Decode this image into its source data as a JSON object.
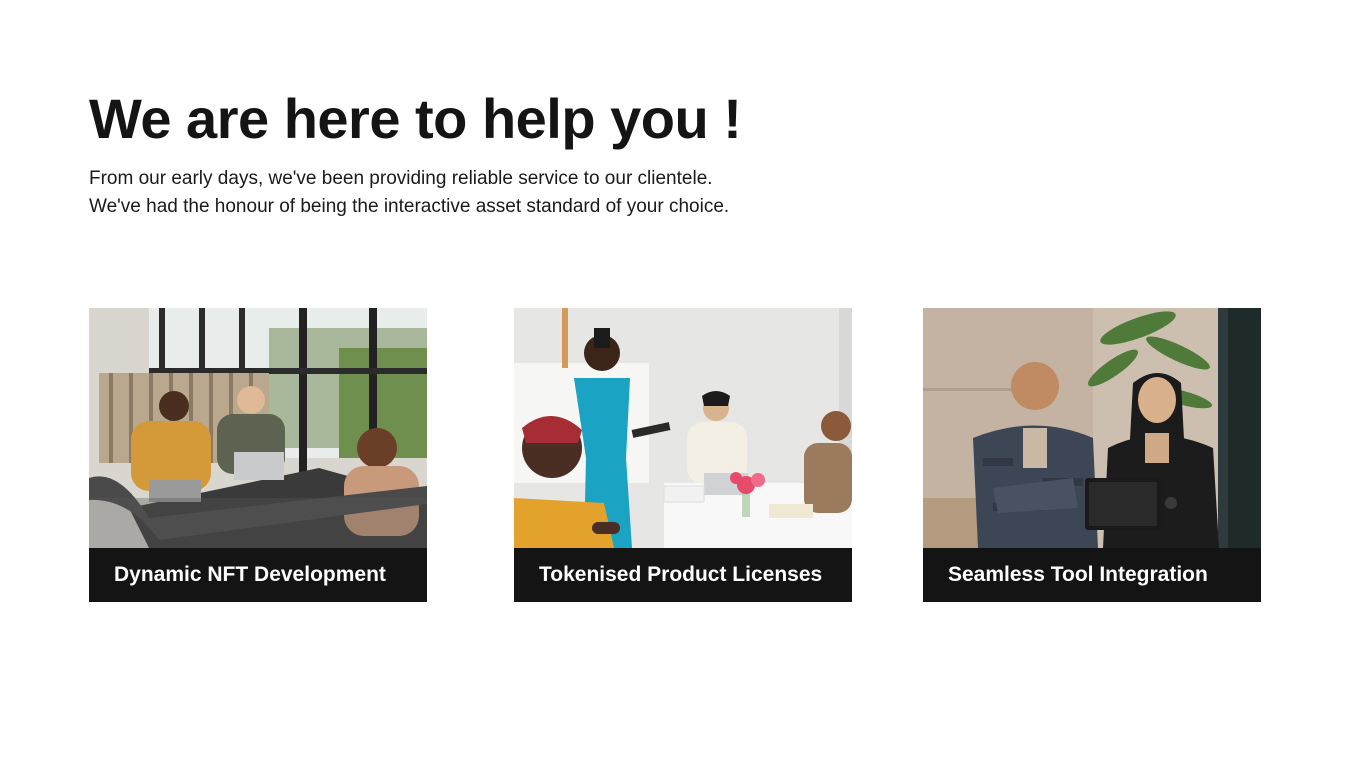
{
  "hero": {
    "title": "We are here to help you !",
    "subtitle_line1": "From our early days, we've been providing reliable service to our clientele.",
    "subtitle_line2": "We've had the honour of being the interactive asset standard of your choice."
  },
  "services": [
    {
      "label": "Dynamic NFT Development",
      "image": "team-meeting-office-photo"
    },
    {
      "label": "Tokenised Product Licenses",
      "image": "presentation-meeting-photo"
    },
    {
      "label": "Seamless Tool Integration",
      "image": "tablet-discussion-photo"
    }
  ],
  "colors": {
    "text": "#141414",
    "label_bg": "#141414",
    "label_text": "#ffffff",
    "background": "#ffffff"
  }
}
